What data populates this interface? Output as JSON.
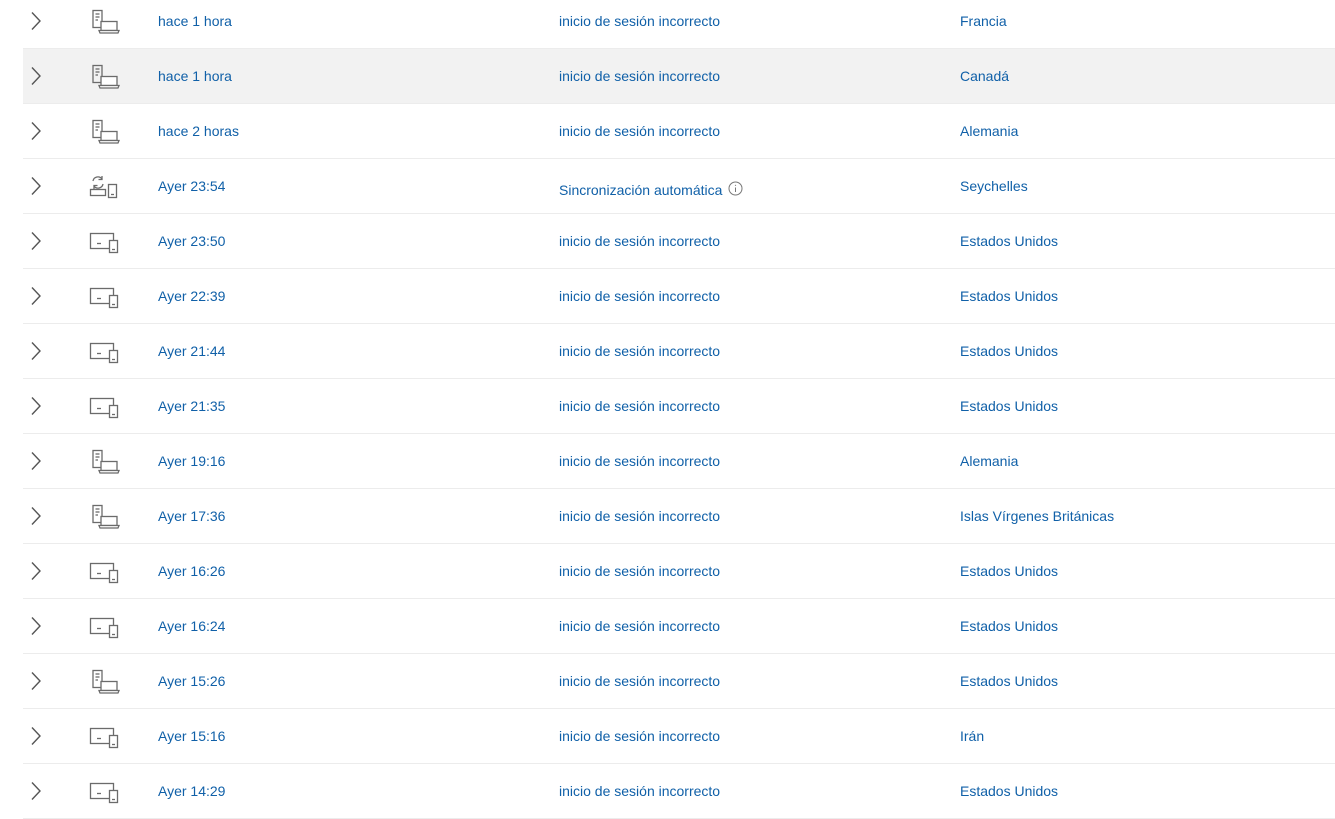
{
  "activity": {
    "rows": [
      {
        "time": "hace 1 hora",
        "activity": "inicio de sesión incorrecto",
        "location": "Francia",
        "device_icon": "server-laptop-icon",
        "hover": false
      },
      {
        "time": "hace 1 hora",
        "activity": "inicio de sesión incorrecto",
        "location": "Canadá",
        "device_icon": "server-laptop-icon",
        "hover": true
      },
      {
        "time": "hace 2 horas",
        "activity": "inicio de sesión incorrecto",
        "location": "Alemania",
        "device_icon": "server-laptop-icon",
        "hover": false
      },
      {
        "time": "Ayer 23:54",
        "activity": "Sincronización automática",
        "location": "Seychelles",
        "device_icon": "sync-devices-icon",
        "hover": false,
        "has_info": true
      },
      {
        "time": "Ayer 23:50",
        "activity": "inicio de sesión incorrecto",
        "location": "Estados Unidos",
        "device_icon": "monitor-phone-icon",
        "hover": false
      },
      {
        "time": "Ayer 22:39",
        "activity": "inicio de sesión incorrecto",
        "location": "Estados Unidos",
        "device_icon": "monitor-phone-icon",
        "hover": false
      },
      {
        "time": "Ayer 21:44",
        "activity": "inicio de sesión incorrecto",
        "location": "Estados Unidos",
        "device_icon": "monitor-phone-icon",
        "hover": false
      },
      {
        "time": "Ayer 21:35",
        "activity": "inicio de sesión incorrecto",
        "location": "Estados Unidos",
        "device_icon": "monitor-phone-icon",
        "hover": false
      },
      {
        "time": "Ayer 19:16",
        "activity": "inicio de sesión incorrecto",
        "location": "Alemania",
        "device_icon": "server-laptop-icon",
        "hover": false
      },
      {
        "time": "Ayer 17:36",
        "activity": "inicio de sesión incorrecto",
        "location": "Islas Vírgenes Británicas",
        "device_icon": "server-laptop-icon",
        "hover": false
      },
      {
        "time": "Ayer 16:26",
        "activity": "inicio de sesión incorrecto",
        "location": "Estados Unidos",
        "device_icon": "monitor-phone-icon",
        "hover": false
      },
      {
        "time": "Ayer 16:24",
        "activity": "inicio de sesión incorrecto",
        "location": "Estados Unidos",
        "device_icon": "monitor-phone-icon",
        "hover": false
      },
      {
        "time": "Ayer 15:26",
        "activity": "inicio de sesión incorrecto",
        "location": "Estados Unidos",
        "device_icon": "server-laptop-icon",
        "hover": false
      },
      {
        "time": "Ayer 15:16",
        "activity": "inicio de sesión incorrecto",
        "location": "Irán",
        "device_icon": "monitor-phone-icon",
        "hover": false
      },
      {
        "time": "Ayer 14:29",
        "activity": "inicio de sesión incorrecto",
        "location": "Estados Unidos",
        "device_icon": "monitor-phone-icon",
        "hover": false
      }
    ]
  },
  "colors": {
    "link": "#1060a8",
    "hover_row": "#f2f2f2",
    "divider": "#ececec",
    "icon": "#6b6b6b"
  }
}
